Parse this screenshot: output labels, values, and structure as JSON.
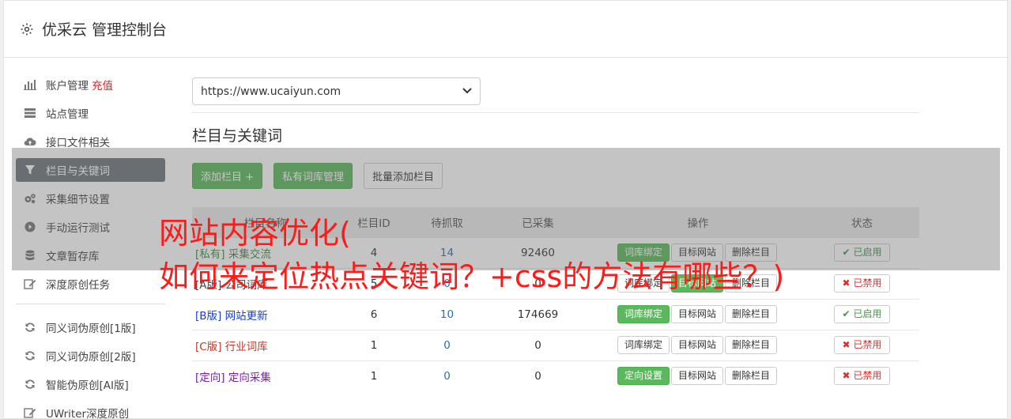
{
  "header": {
    "title": "优采云 管理控制台",
    "icon": "gear-icon"
  },
  "sidebar": {
    "items": [
      {
        "label": "账户管理",
        "extra": "充值",
        "icon": "bar-chart-icon"
      },
      {
        "label": "站点管理",
        "icon": "server-icon"
      },
      {
        "label": "接口文件相关",
        "icon": "cloud-upload-icon"
      },
      {
        "label": "栏目与关键词",
        "icon": "filter-icon",
        "active": true
      },
      {
        "label": "采集细节设置",
        "icon": "cogs-icon"
      },
      {
        "label": "手动运行测试",
        "icon": "play-icon"
      },
      {
        "label": "文章暂存库",
        "icon": "database-icon"
      },
      {
        "label": "深度原创任务",
        "icon": "edit-icon"
      }
    ],
    "items2": [
      {
        "label": "同义词伪原创[1版]",
        "icon": "refresh-icon"
      },
      {
        "label": "同义词伪原创[2版]",
        "icon": "refresh-icon"
      },
      {
        "label": "智能伪原创[AI版]",
        "icon": "refresh-icon"
      },
      {
        "label": "UWriter深度原创",
        "icon": "edit-icon"
      }
    ]
  },
  "main": {
    "site_select": "https://www.ucaiyun.com",
    "section_title": "栏目与关键词",
    "buttons": {
      "add": "添加栏目 +",
      "private": "私有词库管理",
      "batch": "批量添加栏目"
    },
    "columns": [
      "栏目名称",
      "栏目ID",
      "待抓取",
      "已采集",
      "操作",
      "状态"
    ],
    "rows": [
      {
        "tag": "[私有]",
        "name": "采集交流",
        "id": "4",
        "pending": "14",
        "collected": "92460",
        "op1": "词库绑定",
        "op2": "目标网站",
        "op3": "删除栏目",
        "status": "已启用"
      },
      {
        "tag": "[A版]",
        "name": "公司词库",
        "id": "5",
        "pending": "0",
        "collected": "0",
        "op1": "词库绑定",
        "op2": "目标网站",
        "op3": "删除栏目",
        "status": "已禁用"
      },
      {
        "tag": "[B版]",
        "name": "网站更新",
        "id": "6",
        "pending": "10",
        "collected": "174669",
        "op1": "词库绑定",
        "op2": "目标网站",
        "op3": "删除栏目",
        "status": "已启用"
      },
      {
        "tag": "[C版]",
        "name": "行业词库",
        "id": "1",
        "pending": "0",
        "collected": "0",
        "op1": "词库绑定",
        "op2": "目标网站",
        "op3": "删除栏目",
        "status": "已禁用"
      },
      {
        "tag": "[定向]",
        "name": "定向采集",
        "id": "1",
        "pending": "0",
        "collected": "0",
        "op1": "定向设置",
        "op2": "目标网站",
        "op3": "删除栏目",
        "status": "已禁用"
      }
    ]
  },
  "overlay": {
    "line1": "网站内容优化(",
    "line2": "如何来定位热点关键词？+css的方法有哪些？)"
  },
  "colors": {
    "accent_green": "#5cb85c",
    "active_nav": "#6c757d",
    "overlay_text": "#ff1a1a"
  }
}
